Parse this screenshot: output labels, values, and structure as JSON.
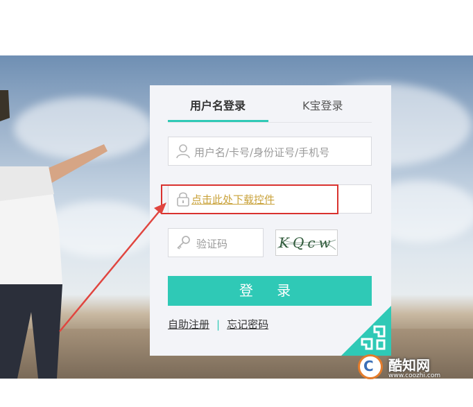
{
  "tabs": {
    "username_login": "用户名登录",
    "k_bao_login": "K宝登录"
  },
  "username": {
    "placeholder": "用户名/卡号/身份证号/手机号"
  },
  "password": {
    "download_control_link": "点击此处下载控件"
  },
  "captcha": {
    "placeholder": "验证码",
    "image_text": "KQcw"
  },
  "login_button": "登 录",
  "links": {
    "self_register": "自助注册",
    "separator": "|",
    "forgot_password": "忘记密码"
  },
  "watermark": {
    "logo_letter": "C",
    "name": "酷知网",
    "url": "www.coozhi.com"
  },
  "colors": {
    "accent": "#2fc9b6",
    "annotation_red": "#d9322e",
    "link_gold": "#c9a23a"
  },
  "icons": [
    "user-icon",
    "lock-icon",
    "key-icon",
    "annotation-arrow"
  ]
}
